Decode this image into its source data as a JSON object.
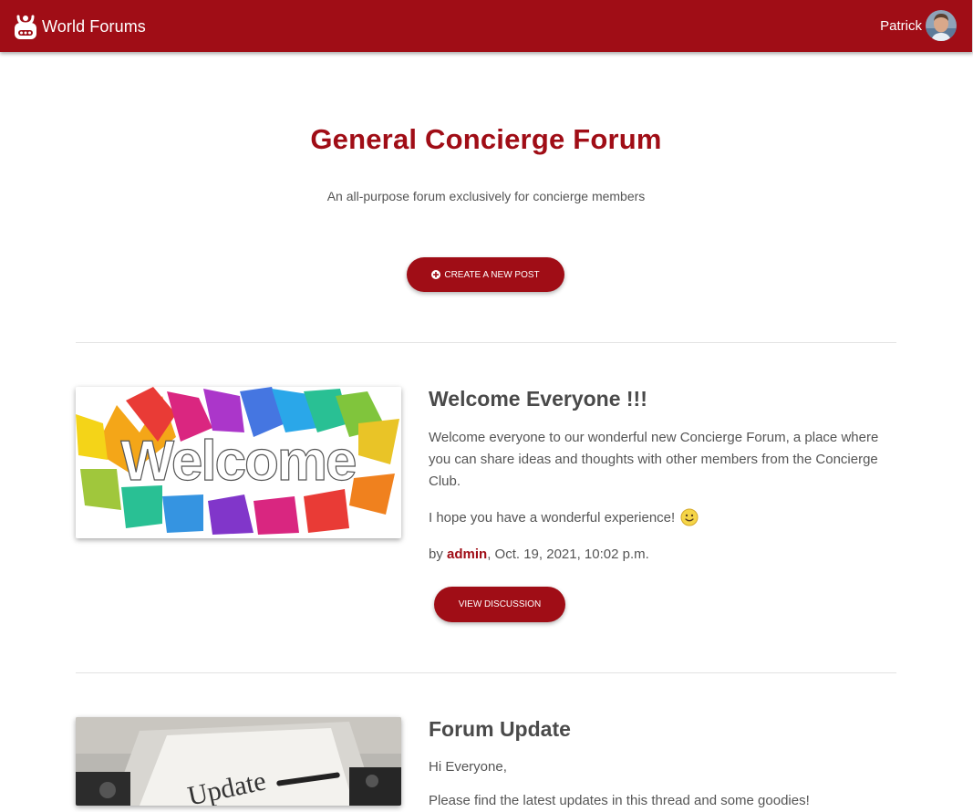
{
  "nav": {
    "brand": "World Forums",
    "user_name": "Patrick"
  },
  "forum": {
    "title": "General Concierge Forum",
    "subtitle": "An all-purpose forum exclusively for concierge members",
    "create_button": "CREATE A NEW POST"
  },
  "posts": [
    {
      "image_text": "Welcome",
      "title": "Welcome Everyone !!!",
      "body": "Welcome everyone to our wonderful new Concierge Forum, a place where you can share ideas and thoughts with other members from the Concierge Club.",
      "body2": "I hope you have a wonderful experience!",
      "meta_by": "by",
      "author": "admin",
      "date": ", Oct. 19, 2021, 10:02 p.m.",
      "button": "VIEW DISCUSSION"
    },
    {
      "image_text": "Update",
      "title": "Forum Update",
      "body": "Hi Everyone,",
      "body2": "Please find the latest updates in this thread and some goodies!"
    }
  ],
  "colors": {
    "brand": "#a00d16",
    "text": "#4a4a4a"
  },
  "icons": [
    "robot-logo-icon",
    "plus-circle-icon",
    "smiley-icon",
    "user-avatar"
  ]
}
